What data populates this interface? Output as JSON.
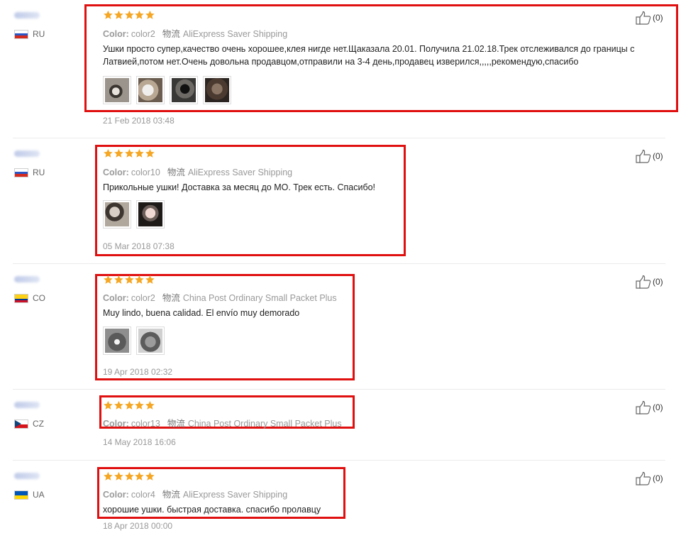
{
  "labels": {
    "color_label": "Color:",
    "shipping_icon": "物流"
  },
  "colors": {
    "star": "#f5a623",
    "highlight": "#e01010"
  },
  "reviews": [
    {
      "country": "RU",
      "flag": "ru",
      "rating": 5,
      "color": "color2",
      "shipping": "AliExpress Saver Shipping",
      "content": "Ушки просто супер,качество очень хорошее,клея нигде нет.Щаказала 20.01. Получила 21.02.18.Трек отслеживался до границы с Латвией,потом нет.Очень довольна продавцом,отправили на 3-4 день,продавец изверился,,,,,рекомендую,спасибо",
      "thumbnails": 4,
      "date": "21 Feb 2018 03:48",
      "likes": "(0)"
    },
    {
      "country": "RU",
      "flag": "ru",
      "rating": 5,
      "color": "color10",
      "shipping": "AliExpress Saver Shipping",
      "content": "Прикольные ушки! Доставка за месяц до МО. Трек есть. Спасибо!",
      "thumbnails": 2,
      "date": "05 Mar 2018 07:38",
      "likes": "(0)"
    },
    {
      "country": "CO",
      "flag": "co",
      "rating": 5,
      "color": "color2",
      "shipping": "China Post Ordinary Small Packet Plus",
      "content": "Muy lindo, buena calidad. El envío muy demorado",
      "thumbnails": 2,
      "date": "19 Apr 2018 02:32",
      "likes": "(0)"
    },
    {
      "country": "CZ",
      "flag": "cz",
      "rating": 5,
      "color": "color13",
      "shipping": "China Post Ordinary Small Packet Plus",
      "content": "",
      "thumbnails": 0,
      "date": "14 May 2018 16:06",
      "likes": "(0)"
    },
    {
      "country": "UA",
      "flag": "ua",
      "rating": 5,
      "color": "color4",
      "shipping": "AliExpress Saver Shipping",
      "content": "хорошие ушки. быстрая доставка. спасибо пролавцу",
      "thumbnails": 0,
      "date": "18 Apr 2018 00:00",
      "likes": "(0)"
    }
  ]
}
